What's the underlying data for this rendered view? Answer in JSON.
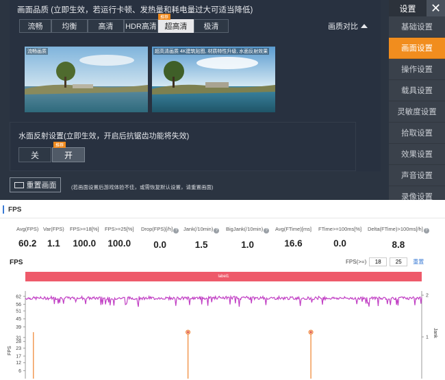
{
  "game": {
    "quality_header": "画面品质 (立即生效，若运行卡顿、发热量和耗电量过大可适当降低)",
    "quality_options": [
      "流畅",
      "均衡",
      "高清",
      "HDR高清",
      "超高清",
      "极清"
    ],
    "quality_selected": "超高清",
    "recommend_tag": "推荐",
    "compare_label": "画质对比",
    "preview_left_label": "流畅画质",
    "preview_right_label": "超高清画质  4K建筑贴图, 材质特性升级, 水面反射效果",
    "water_title": "水面反射设置(立即生效，开启后抗锯齿功能将失效)",
    "water_off": "关",
    "water_on": "开",
    "water_tag": "推荐",
    "reset_label": "重置画面",
    "reset_hint": "(若画面设置后游戏体验不佳，或需恢复默认设置，请重置画面)"
  },
  "menu": {
    "title": "设置",
    "close": "✕",
    "items": [
      "基础设置",
      "画面设置",
      "操作设置",
      "载具设置",
      "灵敏度设置",
      "拾取设置",
      "效果设置",
      "声音设置",
      "录像设置"
    ],
    "active": "画面设置"
  },
  "report": {
    "section_title": "FPS",
    "stats": [
      {
        "label": "Avg(FPS)",
        "value": "60.2",
        "help": false
      },
      {
        "label": "Var(FPS)",
        "value": "1.1",
        "help": false
      },
      {
        "label": "FPS>=18[%]",
        "value": "100.0",
        "help": false
      },
      {
        "label": "FPS>=25[%]",
        "value": "100.0",
        "help": false
      },
      {
        "label": "Drop(FPS)[/h]",
        "value": "0.0",
        "help": true
      },
      {
        "label": "Jank(/10min)",
        "value": "1.5",
        "help": true
      },
      {
        "label": "BigJank(/10min)",
        "value": "1.0",
        "help": true
      },
      {
        "label": "Avg(FTime)[ms]",
        "value": "16.6",
        "help": false
      },
      {
        "label": "FTime>=100ms[%]",
        "value": "0.0",
        "help": false
      },
      {
        "label": "Delta(FTime)>100ms[/h]",
        "value": "8.8",
        "help": true
      }
    ],
    "chart_title": "FPS",
    "fps_threshold_label": "FPS(>=)",
    "fps_threshold_1": "18",
    "fps_threshold_2": "25",
    "reset_label": "重置",
    "label_bar": "label1"
  },
  "colors": {
    "accent": "#f18d1e",
    "fps_line": "#c13fc4",
    "jank": "#f08a3a",
    "label_bar": "#ee5a6a",
    "link": "#3a7bd5"
  },
  "chart_data": {
    "type": "line",
    "title": "FPS",
    "ylabel": "FPS",
    "y2label": "Jank",
    "y_ticks": [
      6,
      12,
      17,
      23,
      28,
      31,
      39,
      45,
      51,
      56,
      62
    ],
    "y2_ticks": [
      1,
      2
    ],
    "ylim": [
      0,
      66
    ],
    "y2lim": [
      0,
      2.1
    ],
    "series": [
      {
        "type": "line",
        "approx_mean": 60.2,
        "min": 54,
        "max": 62
      },
      {
        "type": "jank",
        "events": [
          {
            "position": 0.01,
            "value": 35
          },
          {
            "position": 0.4,
            "value": 35
          },
          {
            "position": 0.71,
            "value": 35
          }
        ]
      }
    ],
    "legend": "none",
    "grid": false
  }
}
